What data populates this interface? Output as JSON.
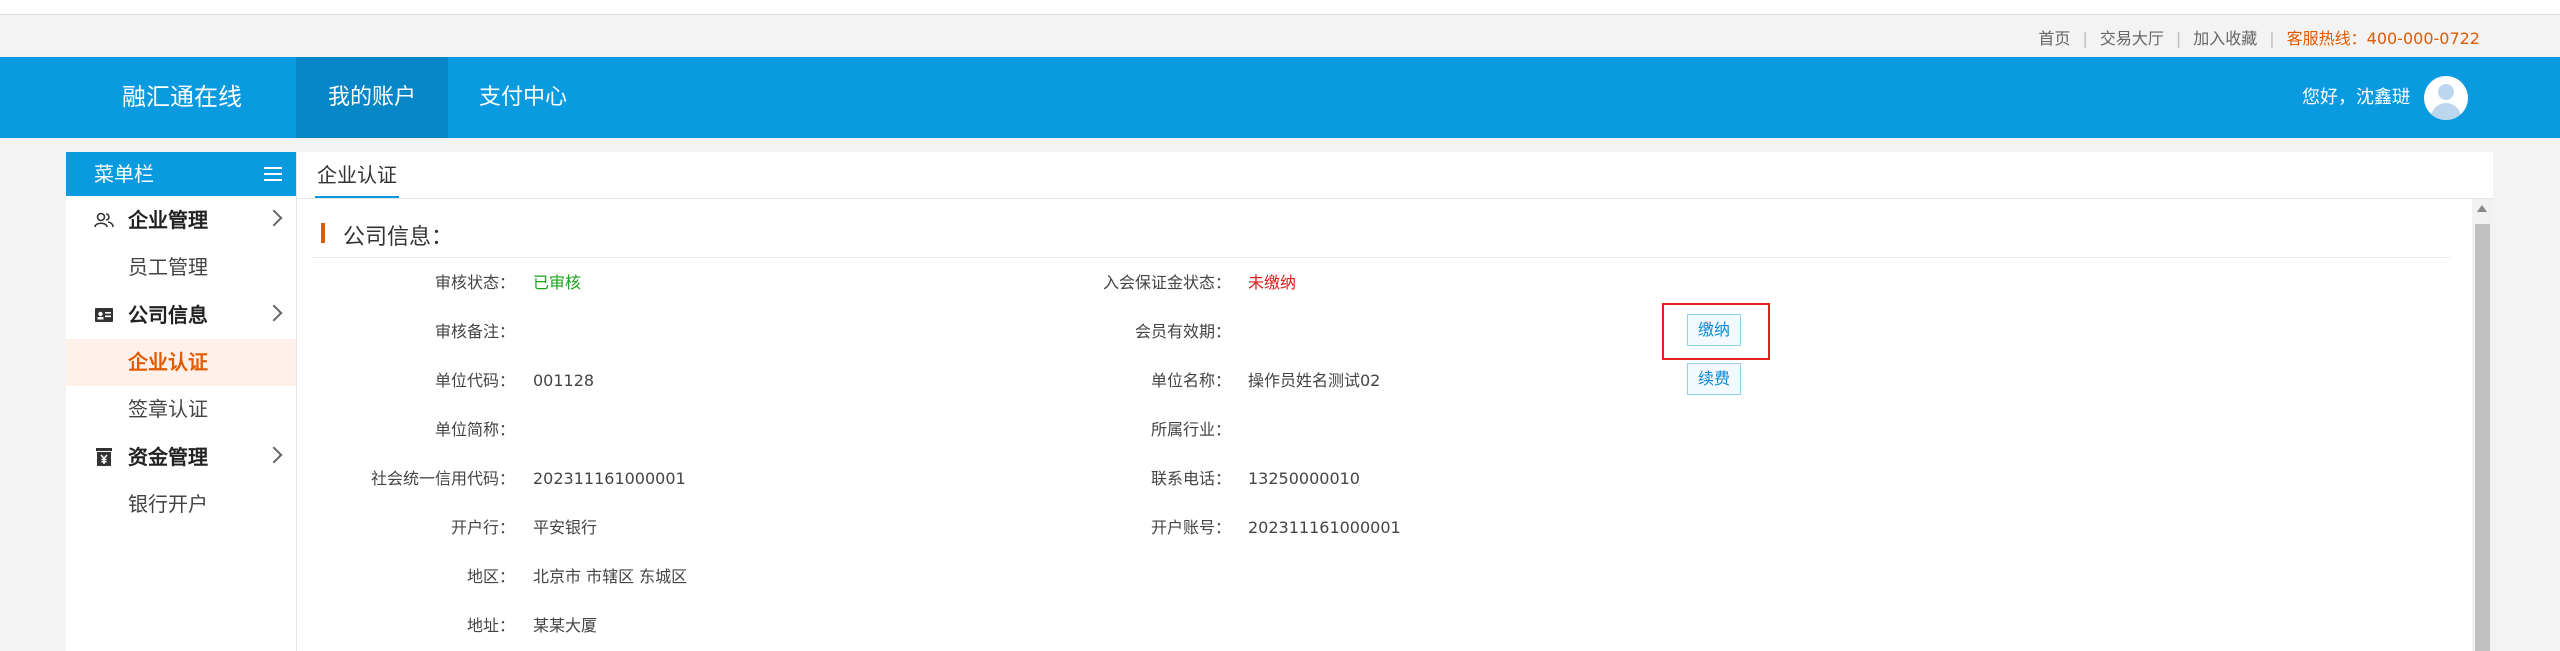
{
  "toplinks": {
    "home": "首页",
    "trade_hall": "交易大厅",
    "bookmark": "加入收藏",
    "hotline": "客服热线：400-000-0722"
  },
  "nav": {
    "brand": "融汇通在线",
    "tabs": [
      {
        "label": "我的账户",
        "active": true
      },
      {
        "label": "支付中心",
        "active": false
      }
    ],
    "greeting": "您好，沈鑫琎"
  },
  "sidebar": {
    "title": "菜单栏",
    "groups": [
      {
        "label": "企业管理",
        "icon": "users-icon",
        "items": [
          {
            "label": "员工管理",
            "active": false
          }
        ]
      },
      {
        "label": "公司信息",
        "icon": "id-card-icon",
        "items": [
          {
            "label": "企业认证",
            "active": true
          },
          {
            "label": "签章认证",
            "active": false
          }
        ]
      },
      {
        "label": "资金管理",
        "icon": "money-icon",
        "items": [
          {
            "label": "银行开户",
            "active": false
          }
        ]
      }
    ]
  },
  "main": {
    "tab": "企业认证",
    "section_title": "公司信息：",
    "left_fields": [
      {
        "label": "审核状态：",
        "value": "已审核",
        "status": "green"
      },
      {
        "label": "审核备注：",
        "value": ""
      },
      {
        "label": "单位代码：",
        "value": "001128"
      },
      {
        "label": "单位简称：",
        "value": ""
      },
      {
        "label": "社会统一信用代码：",
        "value": "202311161000001"
      },
      {
        "label": "开户行：",
        "value": "平安银行"
      },
      {
        "label": "地区：",
        "value": "北京市 市辖区 东城区"
      },
      {
        "label": "地址：",
        "value": "某某大厦"
      }
    ],
    "right_fields": [
      {
        "label": "入会保证金状态：",
        "value": "未缴纳",
        "status": "red"
      },
      {
        "label": "会员有效期：",
        "value": ""
      },
      {
        "label": "单位名称：",
        "value": "操作员姓名测试02"
      },
      {
        "label": "所属行业：",
        "value": ""
      },
      {
        "label": "联系电话：",
        "value": "13250000010"
      },
      {
        "label": "开户账号：",
        "value": "202311161000001"
      }
    ],
    "pay_button": "缴纳",
    "renew_button": "续费",
    "colors": {
      "accent": "#0a9ae0",
      "highlight": "#e31f1f",
      "orange": "#e05a00"
    }
  }
}
